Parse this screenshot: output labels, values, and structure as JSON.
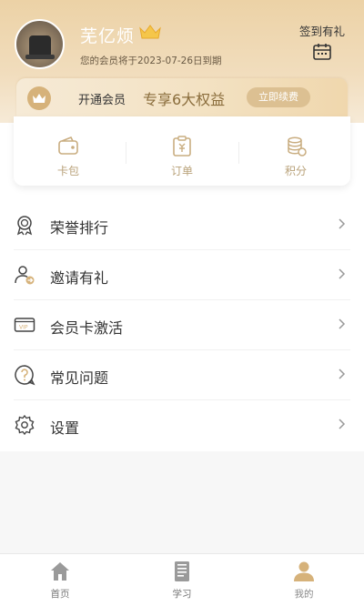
{
  "profile": {
    "username": "芜亿烦",
    "expire_text": "您的会员将于2023-07-26日到期"
  },
  "signin": {
    "label": "签到有礼",
    "icon": "calendar-icon"
  },
  "vip": {
    "open_label": "开通会员",
    "rights_text": "专享6大权益",
    "renew_button": "立即续费",
    "accent": "#dcc092"
  },
  "quick": [
    {
      "label": "卡包",
      "icon": "wallet-icon"
    },
    {
      "label": "订单",
      "icon": "order-icon"
    },
    {
      "label": "积分",
      "icon": "coins-icon"
    }
  ],
  "menu": [
    {
      "label": "荣誉排行",
      "icon": "medal-icon"
    },
    {
      "label": "邀请有礼",
      "icon": "invite-user-icon"
    },
    {
      "label": "会员卡激活",
      "icon": "vip-card-icon"
    },
    {
      "label": "常见问题",
      "icon": "question-icon"
    },
    {
      "label": "设置",
      "icon": "gear-icon"
    }
  ],
  "tabs": [
    {
      "label": "首页",
      "icon": "home-icon"
    },
    {
      "label": "学习",
      "icon": "book-icon"
    },
    {
      "label": "我的",
      "icon": "user-icon",
      "active": true
    }
  ]
}
